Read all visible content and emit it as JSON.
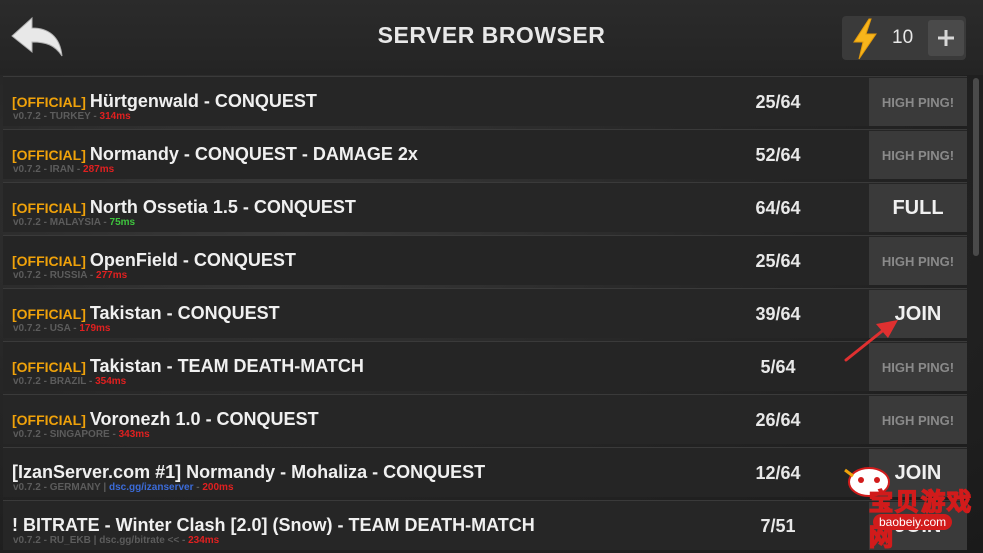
{
  "header": {
    "title": "SERVER BROWSER",
    "energy_count": "10",
    "back_icon": "back-arrow-icon",
    "energy_icon": "lightning-bolt-icon",
    "plus_label": "+"
  },
  "colors": {
    "official_tag": "#f0a20a",
    "ping_high": "#e02020",
    "ping_good": "#3ec43e",
    "discord_link": "#3b6bd8",
    "arrow": "#e03030"
  },
  "servers": [
    {
      "tag": "[OFFICIAL]",
      "name": "Hürtgenwald - CONQUEST",
      "version": "v0.7.2",
      "region": "TURKEY",
      "link": "",
      "ping": "314ms",
      "ping_status": "high",
      "players": "25/64",
      "action": "HIGH PING!"
    },
    {
      "tag": "[OFFICIAL]",
      "name": "Normandy - CONQUEST - DAMAGE 2x",
      "version": "v0.7.2",
      "region": "IRAN",
      "link": "",
      "ping": "287ms",
      "ping_status": "high",
      "players": "52/64",
      "action": "HIGH PING!"
    },
    {
      "tag": "[OFFICIAL]",
      "name": "North Ossetia 1.5 - CONQUEST",
      "version": "v0.7.2",
      "region": "MALAYSIA",
      "link": "",
      "ping": "75ms",
      "ping_status": "good",
      "players": "64/64",
      "action": "FULL"
    },
    {
      "tag": "[OFFICIAL]",
      "name": "OpenField - CONQUEST",
      "version": "v0.7.2",
      "region": "RUSSIA",
      "link": "",
      "ping": "277ms",
      "ping_status": "high",
      "players": "25/64",
      "action": "HIGH PING!"
    },
    {
      "tag": "[OFFICIAL]",
      "name": "Takistan - CONQUEST",
      "version": "v0.7.2",
      "region": "USA",
      "link": "",
      "ping": "179ms",
      "ping_status": "high",
      "players": "39/64",
      "action": "JOIN"
    },
    {
      "tag": "[OFFICIAL]",
      "name": "Takistan - TEAM DEATH-MATCH",
      "version": "v0.7.2",
      "region": "BRAZIL",
      "link": "",
      "ping": "354ms",
      "ping_status": "high",
      "players": "5/64",
      "action": "HIGH PING!"
    },
    {
      "tag": "[OFFICIAL]",
      "name": "Voronezh 1.0 - CONQUEST",
      "version": "v0.7.2",
      "region": "SINGAPORE",
      "link": "",
      "ping": "343ms",
      "ping_status": "high",
      "players": "26/64",
      "action": "HIGH PING!"
    },
    {
      "tag": "",
      "name": "[IzanServer.com #1] Normandy - Mohaliza - CONQUEST",
      "version": "v0.7.2",
      "region": "GERMANY",
      "link": "dsc.gg/izanserver",
      "ping": "200ms",
      "ping_status": "high",
      "players": "12/64",
      "action": "JOIN"
    },
    {
      "tag": "",
      "name": "! BITRATE - Winter Clash [2.0] (Snow) - TEAM DEATH-MATCH",
      "version": "v0.7.2",
      "region": "RU_EKB",
      "link": "dsc.gg/bitrate <<",
      "ping": "234ms",
      "ping_status": "high",
      "players": "7/51",
      "action": "JOIN"
    }
  ],
  "watermark": {
    "text": "宝贝游戏网",
    "url": "baobeiy.com"
  }
}
